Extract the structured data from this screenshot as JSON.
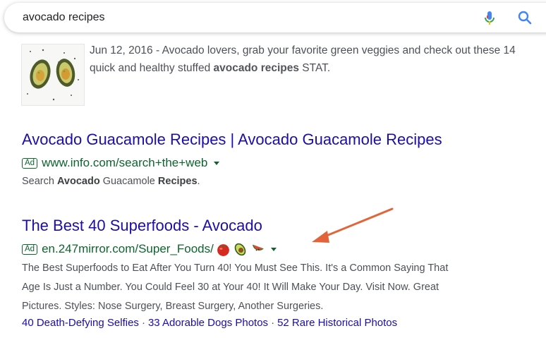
{
  "search": {
    "query": "avocado recipes"
  },
  "result1": {
    "date": "Jun 12, 2016 - ",
    "snippet_a": "Avocado lovers, grab your favorite green veggies and check out these 14 quick and healthy stuffed ",
    "snippet_bold": "avocado recipes",
    "snippet_b": " STAT."
  },
  "ad1": {
    "title": "Avocado Guacamole Recipes | Avocado Guacamole Recipes",
    "badge": "Ad",
    "url": "www.info.com/search+the+web",
    "desc_a": "Search ",
    "desc_b1": "Avocado",
    "desc_c": " Guacamole ",
    "desc_b2": "Recipes",
    "desc_d": "."
  },
  "ad2": {
    "title": "The Best 40 Superfoods - Avocado",
    "badge": "Ad",
    "url": "en.247mirror.com/Super_Foods/",
    "desc_line1": "The Best Superfoods to Eat After You Turn 40! You Must See This. It's a Common Saying That",
    "desc_line2": "Age Is Just a Number. You Could Feel 30 at Your 40! It Will Make Your Day. Visit Now. Great",
    "desc_line3": "Pictures. Styles: Nose Surgery, Breast Surgery, Another Surgeries.",
    "sitelinks": [
      "40 Death-Defying Selfies",
      "33 Adorable Dogs Photos",
      "52 Rare Historical Photos"
    ],
    "sitelink_separator": "·"
  },
  "icons": {
    "mic": "microphone-icon",
    "search": "search-icon",
    "emoji": [
      "tomato-icon",
      "avocado-icon",
      "watermelon-icon"
    ],
    "annotation": "red-arrow"
  },
  "colors": {
    "link": "#1a0dab",
    "ad_green": "#0d652d",
    "arrow": "#e2643b"
  }
}
